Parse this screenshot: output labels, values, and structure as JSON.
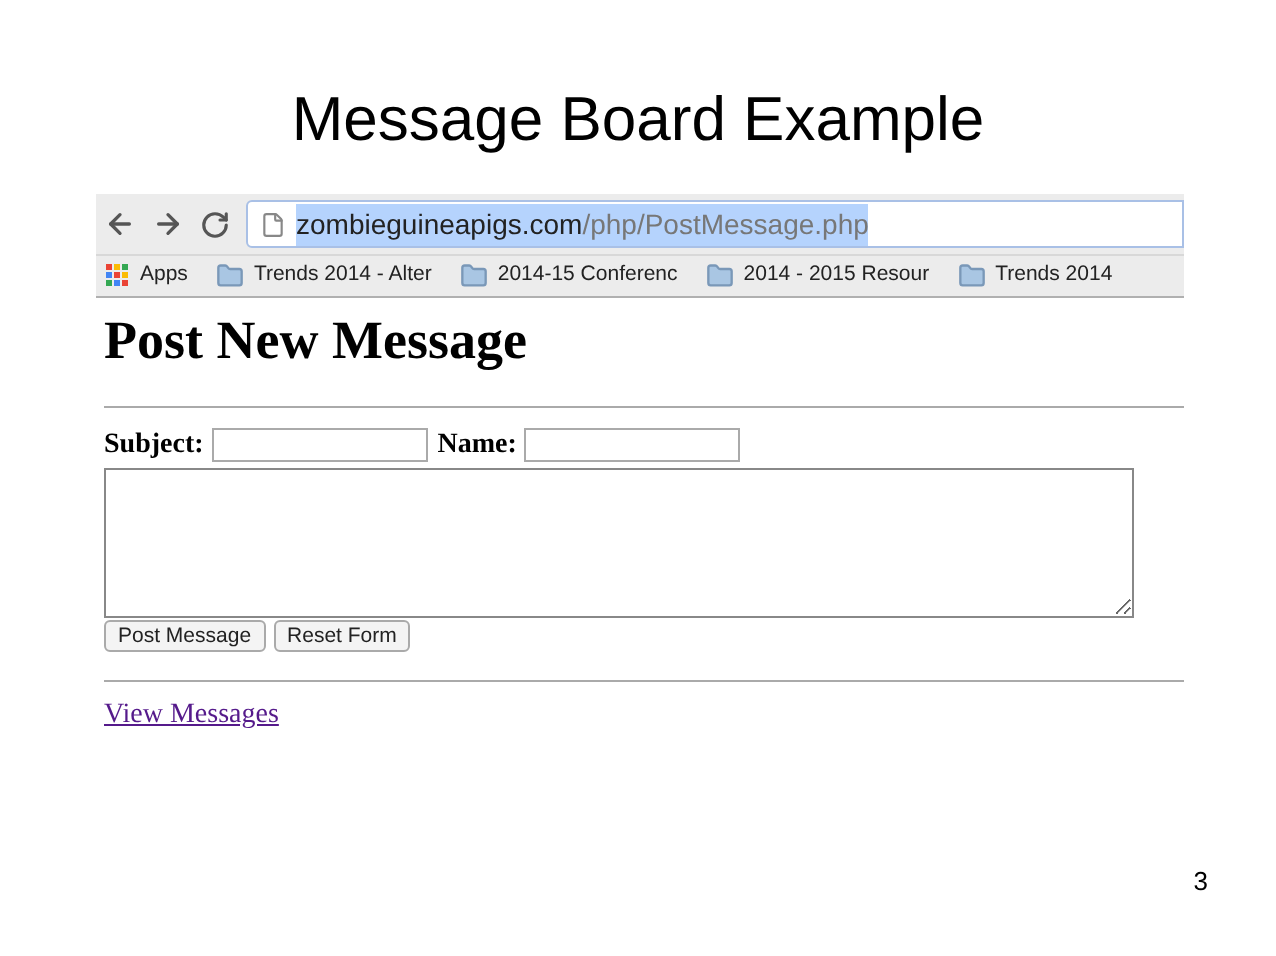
{
  "slide": {
    "title": "Message Board Example",
    "page_number": "3"
  },
  "browser": {
    "url": {
      "host": "zombieguineapigs.com",
      "path": "/php/PostMessage.php",
      "selected": true
    },
    "bookmarks": [
      {
        "kind": "apps",
        "label": "Apps"
      },
      {
        "kind": "folder",
        "label": "Trends 2014 - Alter"
      },
      {
        "kind": "folder",
        "label": "2014-15 Conferenc"
      },
      {
        "kind": "folder",
        "label": "2014 - 2015 Resour"
      },
      {
        "kind": "folder",
        "label": "Trends 2014"
      }
    ]
  },
  "page": {
    "heading": "Post New Message",
    "fields": [
      {
        "label": "Subject:"
      },
      {
        "label": "Name:"
      }
    ],
    "buttons": [
      "Post Message",
      "Reset Form"
    ],
    "link": "View Messages"
  }
}
